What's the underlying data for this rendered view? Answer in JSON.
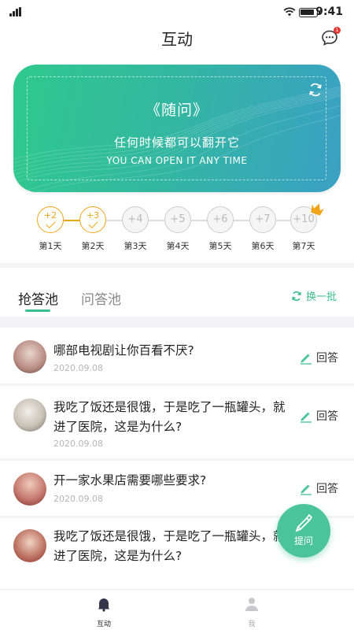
{
  "status_bar": {
    "time": "9:41"
  },
  "nav": {
    "title": "互动",
    "message_badge": "1"
  },
  "banner": {
    "title": "《随问》",
    "subtitle": "任何时候都可以翻开它",
    "subtitle_en": "YOU CAN OPEN IT ANY TIME"
  },
  "checkin": {
    "days": [
      {
        "points": "+2",
        "label": "第1天",
        "done": true
      },
      {
        "points": "+3",
        "label": "第2天",
        "done": true
      },
      {
        "points": "+4",
        "label": "第3天",
        "done": false
      },
      {
        "points": "+5",
        "label": "第4天",
        "done": false
      },
      {
        "points": "+6",
        "label": "第5天",
        "done": false
      },
      {
        "points": "+7",
        "label": "第6天",
        "done": false
      },
      {
        "points": "+10",
        "label": "第7天",
        "done": false
      }
    ]
  },
  "tabs": {
    "active": "抢答池",
    "inactive": "问答池",
    "swap_label": "换一批"
  },
  "questions": [
    {
      "text": "哪部电视剧让你百看不厌?",
      "date": "2020.09.08",
      "action": "回答"
    },
    {
      "text": "我吃了饭还是很饿，于是吃了一瓶罐头，就进了医院，这是为什么?",
      "date": "2020.09.08",
      "action": "回答"
    },
    {
      "text": "开一家水果店需要哪些要求?",
      "date": "2020.09.08",
      "action": "回答"
    },
    {
      "text": "我吃了饭还是很饿，于是吃了一瓶罐头，就进了医院，这是为什么?",
      "date": "",
      "action": ""
    }
  ],
  "fab": {
    "label": "提问"
  },
  "bottom_nav": [
    {
      "label": "互动",
      "active": true
    },
    {
      "label": "我",
      "active": false
    }
  ],
  "colors": {
    "accent": "#3cbd8d",
    "checkin": "#f0a519"
  }
}
